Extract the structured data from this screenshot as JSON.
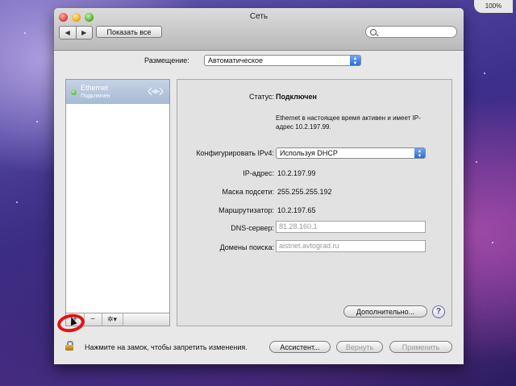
{
  "window": {
    "title": "Сеть"
  },
  "toolbar": {
    "back_label": "◀",
    "forward_label": "▶",
    "show_all_label": "Показать все",
    "search_placeholder": ""
  },
  "location": {
    "label": "Размещение:",
    "value": "Автоматическое"
  },
  "services": [
    {
      "name": "Ethernet",
      "status": "Подключен"
    }
  ],
  "sidebar_tools": {
    "add": "+",
    "remove": "−",
    "gear": "✲▾"
  },
  "detail": {
    "status_label": "Статус:",
    "status_value": "Подключен",
    "status_note": "Ethernet в настоящее время активен и имеет IP-адрес 10.2.197.99.",
    "configure_label": "Конфигурировать IPv4:",
    "configure_value": "Используя DHCP",
    "ip_label": "IP-адрес:",
    "ip_value": "10.2.197.99",
    "mask_label": "Маска подсети:",
    "mask_value": "255.255.255.192",
    "router_label": "Маршрутизатор:",
    "router_value": "10.2.197.65",
    "dns_label": "DNS-сервер:",
    "dns_value": "81.28.160.1",
    "search_domains_label": "Домены поиска:",
    "search_domains_value": "aistnet.avtograd.ru",
    "advanced_label": "Дополнительно...",
    "help_label": "?"
  },
  "footer": {
    "lock_text": "Нажмите на замок, чтобы запретить изменения.",
    "assistant_label": "Ассистент...",
    "revert_label": "Вернуть",
    "apply_label": "Применить"
  },
  "corner_badge": "100%",
  "colors": {
    "selection": "#b3c3dc",
    "popup_arrow": "#2b6ad7",
    "connected": "#3c9a1f",
    "highlight_ring": "#e01414"
  }
}
